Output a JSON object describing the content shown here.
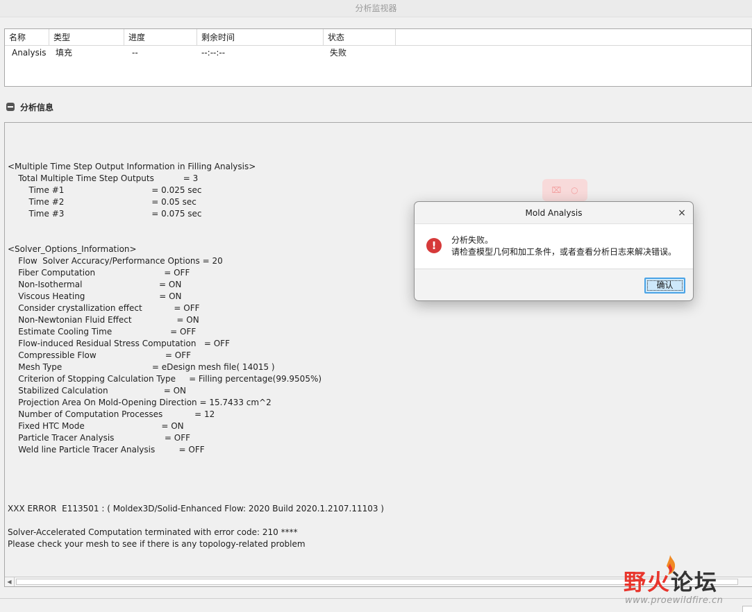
{
  "window": {
    "title": "分析监视器"
  },
  "job_table": {
    "columns": [
      "名称",
      "类型",
      "进度",
      "剩余时间",
      "状态"
    ],
    "rows": [
      [
        "Analysis",
        "填充",
        "--",
        "--:--:--",
        "失败"
      ]
    ]
  },
  "analysis_info": {
    "section_title": "分析信息",
    "log_lines": [
      "<Multiple Time Step Output Information in Filling Analysis>",
      "    Total Multiple Time Step Outputs           = 3",
      "        Time #1                                 = 0.025 sec",
      "        Time #2                                 = 0.05 sec",
      "        Time #3                                 = 0.075 sec",
      "",
      "",
      "<Solver_Options_Information>",
      "    Flow  Solver Accuracy/Performance Options = 20",
      "    Fiber Computation                          = OFF",
      "    Non-Isothermal                             = ON",
      "    Viscous Heating                            = ON",
      "    Consider crystallization effect            = OFF",
      "    Non-Newtonian Fluid Effect                 = ON",
      "    Estimate Cooling Time                      = OFF",
      "    Flow-induced Residual Stress Computation   = OFF",
      "    Compressible Flow                          = OFF",
      "    Mesh Type                                  = eDesign mesh file( 14015 )",
      "    Criterion of Stopping Calculation Type     = Filling percentage(99.9505%)",
      "    Stabilized Calculation                     = ON",
      "    Projection Area On Mold-Opening Direction = 15.7433 cm^2",
      "    Number of Computation Processes            = 12",
      "    Fixed HTC Mode                             = ON",
      "    Particle Tracer Analysis                   = OFF",
      "    Weld line Particle Tracer Analysis         = OFF",
      "",
      "",
      "",
      "",
      "XXX ERROR  E113501 : ( Moldex3D/Solid-Enhanced Flow: 2020 Build 2020.1.2107.11103 )",
      "",
      "Solver-Accelerated Computation terminated with error code: 210 ****",
      "Please check your mesh to see if there is any topology-related problem"
    ]
  },
  "dialog": {
    "title": "Mold Analysis",
    "close_glyph": "×",
    "icon": "error-icon",
    "message_line1": "分析失败。",
    "message_line2": "请检查模型几何和加工条件，或者查看分析日志来解决错误。",
    "ok_label": "确认"
  },
  "watermark": {
    "logo_red": "野火",
    "logo_gray": "论坛",
    "url": "www.proewildfire.cn"
  },
  "colors": {
    "error_red": "#d63a3a",
    "ok_button_bg": "#cde8fb",
    "ok_button_border": "#4aa3e6",
    "watermark_red": "#e8352c"
  }
}
